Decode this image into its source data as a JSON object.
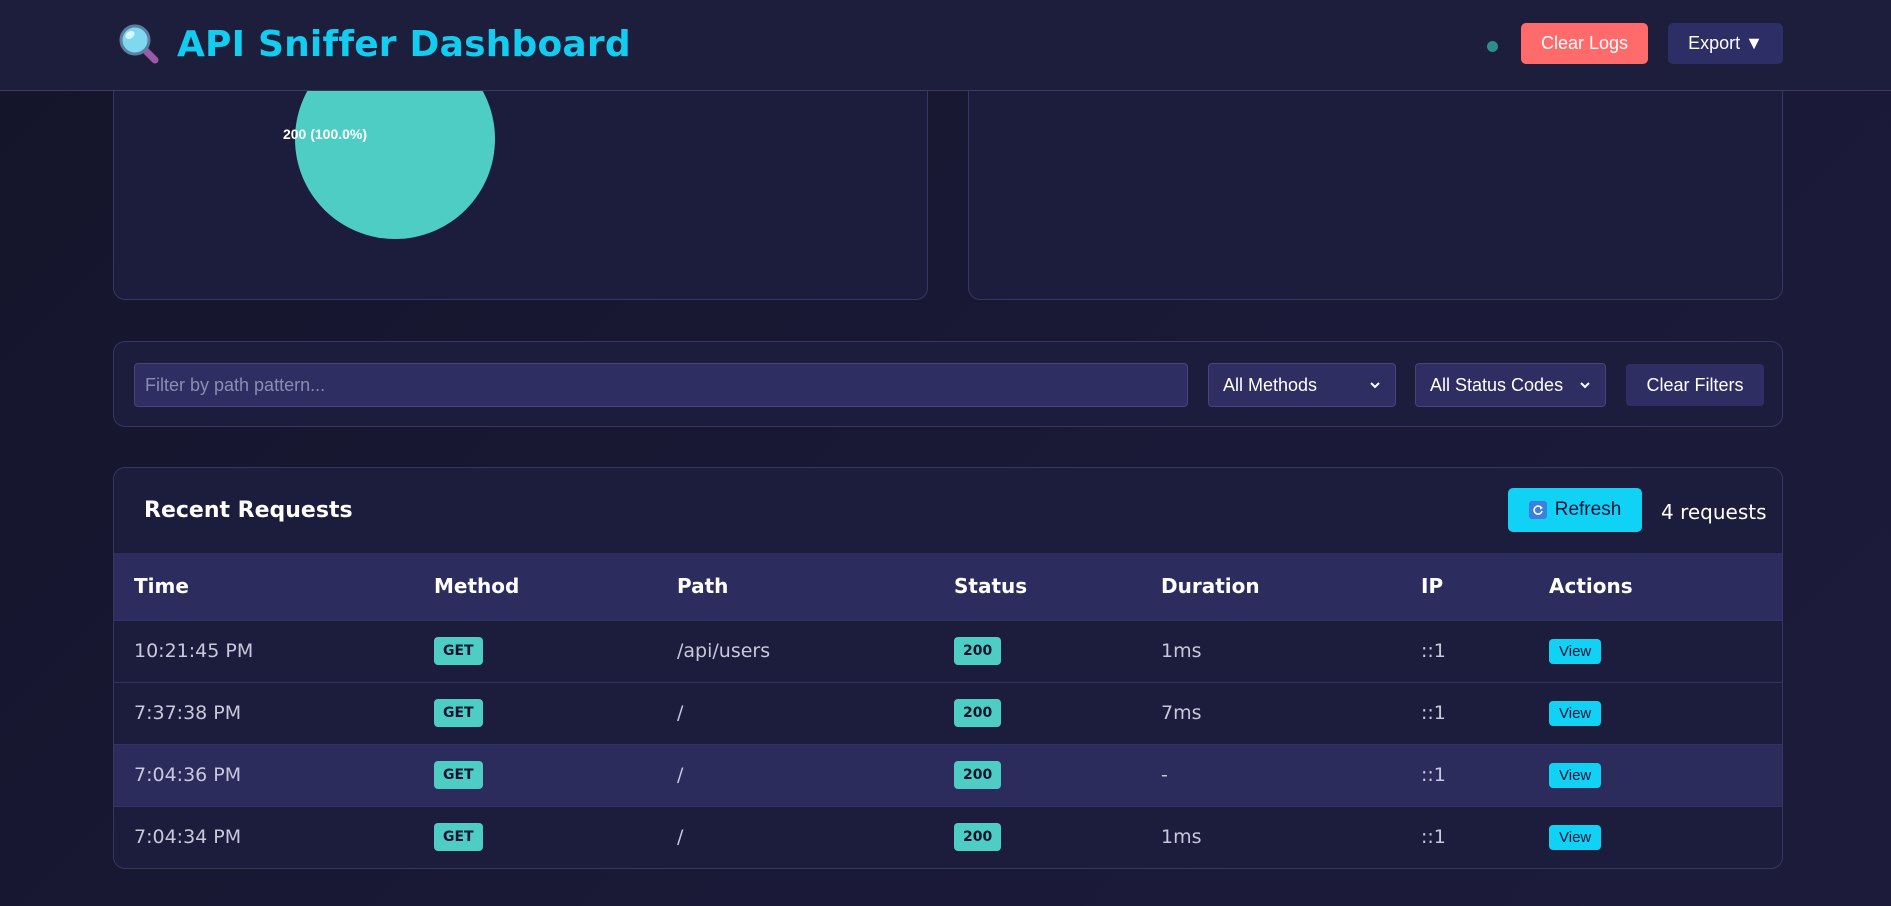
{
  "header": {
    "title": "API Sniffer Dashboard",
    "icon": "magnifier-icon",
    "clear_logs_label": "Clear Logs",
    "export_label": "Export ▼",
    "colors": {
      "brand": "#12cdf0",
      "danger": "#ff6b6b"
    }
  },
  "chart_data": {
    "type": "pie",
    "slices": [
      {
        "label": "200",
        "value": 100.0,
        "color": "#4ecdc4"
      }
    ],
    "slice_label": "200 (100.0%)"
  },
  "filters": {
    "path_placeholder": "Filter by path pattern...",
    "path_value": "",
    "method_selected": "All Methods",
    "status_selected": "All Status Codes",
    "clear_label": "Clear Filters"
  },
  "requests": {
    "title": "Recent Requests",
    "refresh_label": "Refresh",
    "count_label": "4 requests",
    "columns": [
      "Time",
      "Method",
      "Path",
      "Status",
      "Duration",
      "IP",
      "Actions"
    ],
    "rows": [
      {
        "time": "10:21:45 PM",
        "method": "GET",
        "path": "/api/users",
        "status": "200",
        "duration": "1ms",
        "ip": "::1",
        "action": "View"
      },
      {
        "time": "7:37:38 PM",
        "method": "GET",
        "path": "/",
        "status": "200",
        "duration": "7ms",
        "ip": "::1",
        "action": "View"
      },
      {
        "time": "7:04:36 PM",
        "method": "GET",
        "path": "/",
        "status": "200",
        "duration": "-",
        "ip": "::1",
        "action": "View"
      },
      {
        "time": "7:04:34 PM",
        "method": "GET",
        "path": "/",
        "status": "200",
        "duration": "1ms",
        "ip": "::1",
        "action": "View"
      }
    ],
    "colors": {
      "badge": "#4ecdc4",
      "accent": "#0fd2f5"
    }
  }
}
